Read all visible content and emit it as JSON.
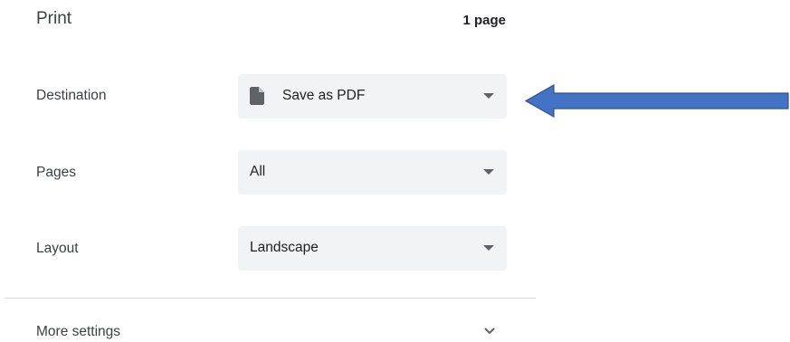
{
  "header": {
    "title": "Print",
    "page_count": "1 page"
  },
  "destination": {
    "label": "Destination",
    "value": "Save as PDF",
    "icon": "document-icon"
  },
  "pages": {
    "label": "Pages",
    "value": "All"
  },
  "layout": {
    "label": "Layout",
    "value": "Landscape"
  },
  "more_settings": {
    "label": "More settings",
    "icon": "chevron-down-icon"
  },
  "annotation": {
    "arrow_color": "#4472c4",
    "arrow_direction": "left"
  },
  "colors": {
    "select_background": "#f1f3f4",
    "text": "#202124",
    "divider": "#dadce0"
  }
}
